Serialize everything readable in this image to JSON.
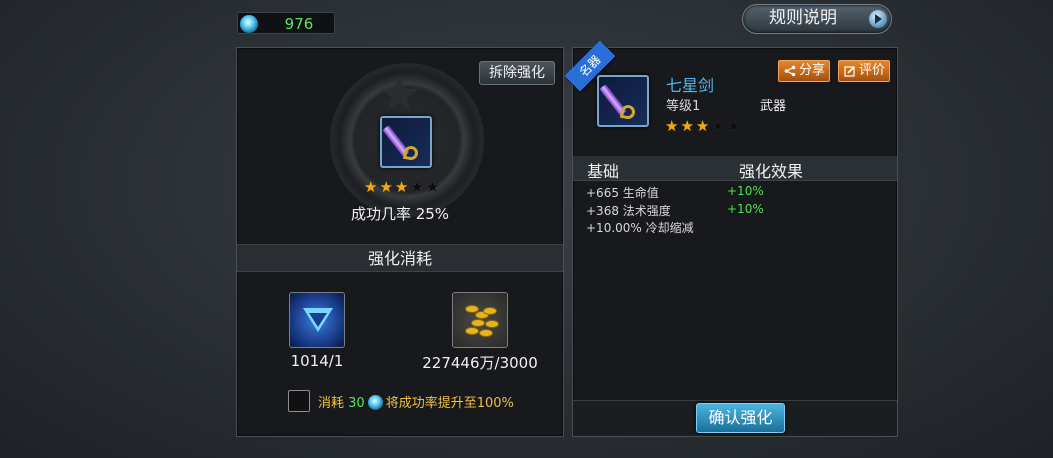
{
  "currency": {
    "icon": "blue-crystal-icon",
    "value": "976"
  },
  "rules_button": {
    "label": "规则说明",
    "icon": "play-arrow-icon"
  },
  "left": {
    "remove_button": "拆除强化",
    "item_icon": "seven-star-sword-icon",
    "stars_filled": 3,
    "stars_total": 5,
    "success_rate": "成功几率 25%",
    "cost_header": "强化消耗",
    "costs": [
      {
        "icon": "blue-triangle-gem-icon",
        "amount": "1014/1"
      },
      {
        "icon": "gold-coins-icon",
        "amount": "227446万/3000"
      }
    ],
    "boost": {
      "prefix": "消耗",
      "amount": "30",
      "suffix": "将成功率提升至100%"
    }
  },
  "right": {
    "ribbon": "名器",
    "item_name": "七星剑",
    "item_level": "等级1",
    "item_type": "武器",
    "stars_filled": 3,
    "stars_total": 5,
    "share_button": "分享",
    "review_button": "评价",
    "stat_headers": {
      "base": "基础",
      "enhance": "强化效果"
    },
    "stats": [
      {
        "base": "+665 生命值",
        "enhance": "+10%"
      },
      {
        "base": "+368 法术强度",
        "enhance": "+10%"
      },
      {
        "base": "+10.00% 冷却缩减",
        "enhance": ""
      }
    ],
    "confirm_button": "确认强化"
  },
  "colors": {
    "accent_blue": "#4fb8f0",
    "currency_green": "#5fe35f",
    "star_gold": "#f2a90c",
    "button_orange": "#e5872b"
  }
}
